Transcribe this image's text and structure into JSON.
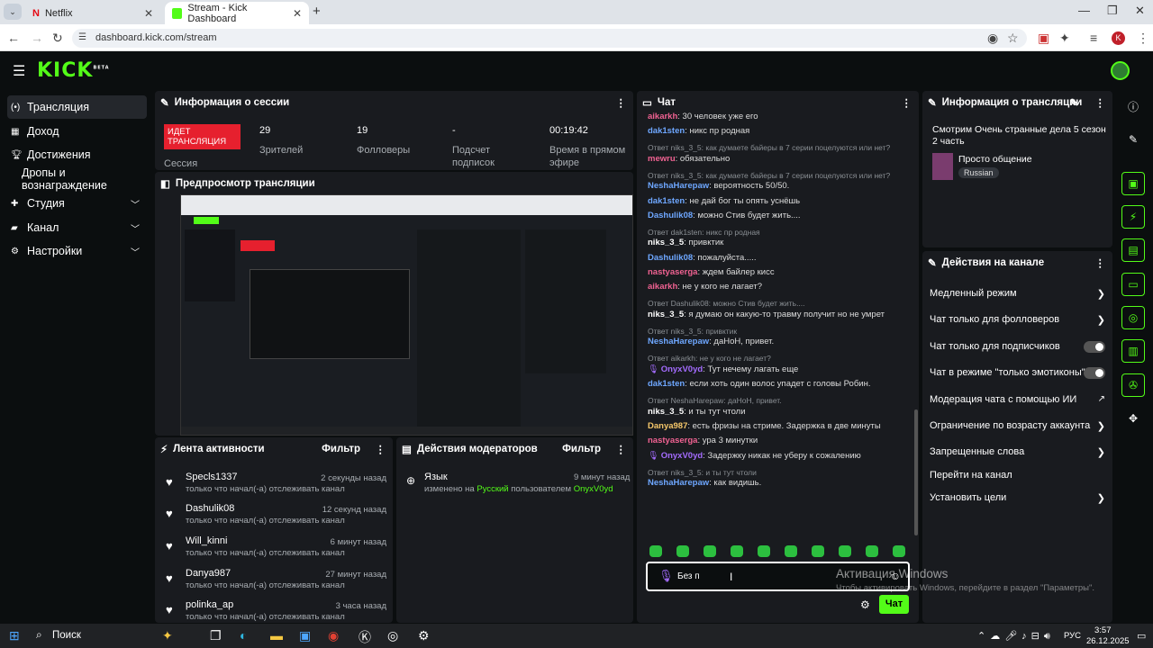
{
  "browser": {
    "tabs": [
      {
        "title": "Netflix"
      },
      {
        "title": "Stream - Kick Dashboard"
      }
    ],
    "url": "dashboard.kick.com/stream"
  },
  "app": {
    "logo": "KICK",
    "logo_badge": "BETA"
  },
  "sidebar": {
    "items": [
      {
        "label": "Трансляция",
        "icon": "broadcast-icon",
        "active": true
      },
      {
        "label": "Доход",
        "icon": "revenue-icon"
      },
      {
        "label": "Достижения",
        "icon": "trophy-icon"
      },
      {
        "label": "Дропы и вознаграждение",
        "icon": ""
      },
      {
        "label": "Студия",
        "icon": "studio-icon",
        "chevron": true
      },
      {
        "label": "Канал",
        "icon": "channel-icon",
        "chevron": true
      },
      {
        "label": "Настройки",
        "icon": "gear-icon",
        "chevron": true
      }
    ]
  },
  "session": {
    "title": "Информация о сессии",
    "badge": "ИДЕТ ТРАНСЛЯЦИЯ",
    "badge_label": "Сессия",
    "stats": [
      {
        "value": "29",
        "label": "Зрителей"
      },
      {
        "value": "19",
        "label": "Фолловеры"
      },
      {
        "value": "-",
        "label": "Подсчет подписок"
      },
      {
        "value": "00:19:42",
        "label": "Время в прямом эфире"
      }
    ]
  },
  "preview": {
    "title": "Предпросмотр трансляции"
  },
  "activity": {
    "title": "Лента активности",
    "filter": "Фильтр",
    "items": [
      {
        "name": "Specls1337",
        "desc": "только что начал(-а) отслеживать канал",
        "time": "2 секунды назад"
      },
      {
        "name": "Dashulik08",
        "desc": "только что начал(-а) отслеживать канал",
        "time": "12 секунд назад"
      },
      {
        "name": "Will_kinni",
        "desc": "только что начал(-а) отслеживать канал",
        "time": "6 минут назад"
      },
      {
        "name": "Danya987",
        "desc": "только что начал(-а) отслеживать канал",
        "time": "27 минут назад"
      },
      {
        "name": "polinka_ap",
        "desc": "только что начал(-а) отслеживать канал",
        "time": "3 часа назад"
      }
    ]
  },
  "mod": {
    "title": "Действия модераторов",
    "filter": "Фильтр",
    "items": [
      {
        "name": "Язык",
        "time": "9 минут назад",
        "desc_a": "изменено на ",
        "desc_lang": "Русский",
        "desc_b": " пользователем ",
        "desc_user": "OnyxV0yd"
      }
    ]
  },
  "chat": {
    "title": "Чат",
    "input_value": "Без п",
    "send": "Чат",
    "lines": [
      {
        "type": "msg",
        "user": "aikarkh",
        "cls": "u-pink",
        "text": ": 30 человек уже его"
      },
      {
        "type": "msg",
        "user": "dak1sten",
        "cls": "u-blue",
        "text": ": никс пр родная"
      },
      {
        "type": "reply",
        "text": "Ответ niks_3_5: как думаете байеры в 7 серии поцелуются или нет?"
      },
      {
        "type": "msg",
        "user": "mewru",
        "cls": "u-pink",
        "text": ": обязательно"
      },
      {
        "type": "reply",
        "text": "Ответ niks_3_5: как думаете байеры в 7 серии поцелуются или нет?"
      },
      {
        "type": "msg",
        "user": "NeshaHarepaw",
        "cls": "u-blue",
        "text": ": вероятность 50/50."
      },
      {
        "type": "msg",
        "user": "dak1sten",
        "cls": "u-blue",
        "text": ": не дай бог ты опять уснёшь"
      },
      {
        "type": "msg",
        "user": "Dashulik08",
        "cls": "u-blue",
        "text": ": можно Стив будет жить...."
      },
      {
        "type": "reply",
        "text": "Ответ dak1sten: никс пр родная"
      },
      {
        "type": "msg",
        "user": "niks_3_5",
        "cls": "u-white",
        "text": ": привктик"
      },
      {
        "type": "msg",
        "user": "Dashulik08",
        "cls": "u-blue",
        "text": ": пожалуйста....."
      },
      {
        "type": "msg",
        "user": "nastyaserga",
        "cls": "u-pink",
        "text": ": ждем байлер кисс"
      },
      {
        "type": "msg",
        "user": "aikarkh",
        "cls": "u-pink",
        "text": ": не у кого не лагает?"
      },
      {
        "type": "reply",
        "text": "Ответ Dashulik08: можно Стив будет жить...."
      },
      {
        "type": "msg",
        "user": "niks_3_5",
        "cls": "u-white",
        "text": ": я думаю он какую-то травму получит но не умрет"
      },
      {
        "type": "reply",
        "text": "Ответ niks_3_5: привктик"
      },
      {
        "type": "msg",
        "user": "NeshaHarepaw",
        "cls": "u-blue",
        "text": ": даНоН, привет."
      },
      {
        "type": "reply",
        "text": "Ответ aikarkh: не у кого не лагает?"
      },
      {
        "type": "msg",
        "user": "OnyxV0yd",
        "cls": "u-purple",
        "text": ": Тут нечему лагать еще",
        "mic": true
      },
      {
        "type": "msg",
        "user": "dak1sten",
        "cls": "u-blue",
        "text": ": если хоть один волос упадет с головы Робин."
      },
      {
        "type": "reply",
        "text": "Ответ NeshaHarepaw: даНоН, привет."
      },
      {
        "type": "msg",
        "user": "niks_3_5",
        "cls": "u-white",
        "text": ": и ты тут чтоли"
      },
      {
        "type": "msg",
        "user": "Danya987",
        "cls": "u-orange",
        "text": ": есть фризы на стриме. Задержка в две минуты"
      },
      {
        "type": "msg",
        "user": "nastyaserga",
        "cls": "u-pink",
        "text": ": ура 3 минутки"
      },
      {
        "type": "msg",
        "user": "OnyxV0yd",
        "cls": "u-purple",
        "text": ": Задержку никак не уберу к сожалению",
        "mic": true
      },
      {
        "type": "reply",
        "text": "Ответ niks_3_5: и ты тут чтоли"
      },
      {
        "type": "msg",
        "user": "NeshaHarepaw",
        "cls": "u-blue",
        "text": ": как видишь."
      }
    ]
  },
  "stream_info": {
    "title": "Информация о трансляции",
    "stream_title": "Смотрим Очень странные дела 5 сезон 2 часть",
    "category": "Просто общение",
    "tag": "Russian"
  },
  "channel_actions": {
    "title": "Действия на канале",
    "items": [
      {
        "label": "Медленный режим",
        "ctrl": "chevron"
      },
      {
        "label": "Чат только для фолловеров",
        "ctrl": "chevron"
      },
      {
        "label": "Чат только для подписчиков",
        "ctrl": "toggle"
      },
      {
        "label": "Чат в режиме \"только эмотиконы\"",
        "ctrl": "toggle"
      },
      {
        "label": "Модерация чата с помощью ИИ",
        "ctrl": "external"
      },
      {
        "label": "Ограничение по возрасту аккаунта",
        "ctrl": "chevron"
      },
      {
        "label": "Запрещенные слова",
        "ctrl": "chevron"
      },
      {
        "label": "Перейти на канал",
        "ctrl": "none"
      },
      {
        "label": "Установить цели",
        "ctrl": "chevron"
      }
    ]
  },
  "watermark": {
    "line1": "Активация Windows",
    "line2": "Чтобы активировать Windows, перейдите в раздел \"Параметры\"."
  },
  "taskbar": {
    "search": "Поиск",
    "lang": "РУС",
    "time": "3:57",
    "date": "26.12.2025"
  }
}
